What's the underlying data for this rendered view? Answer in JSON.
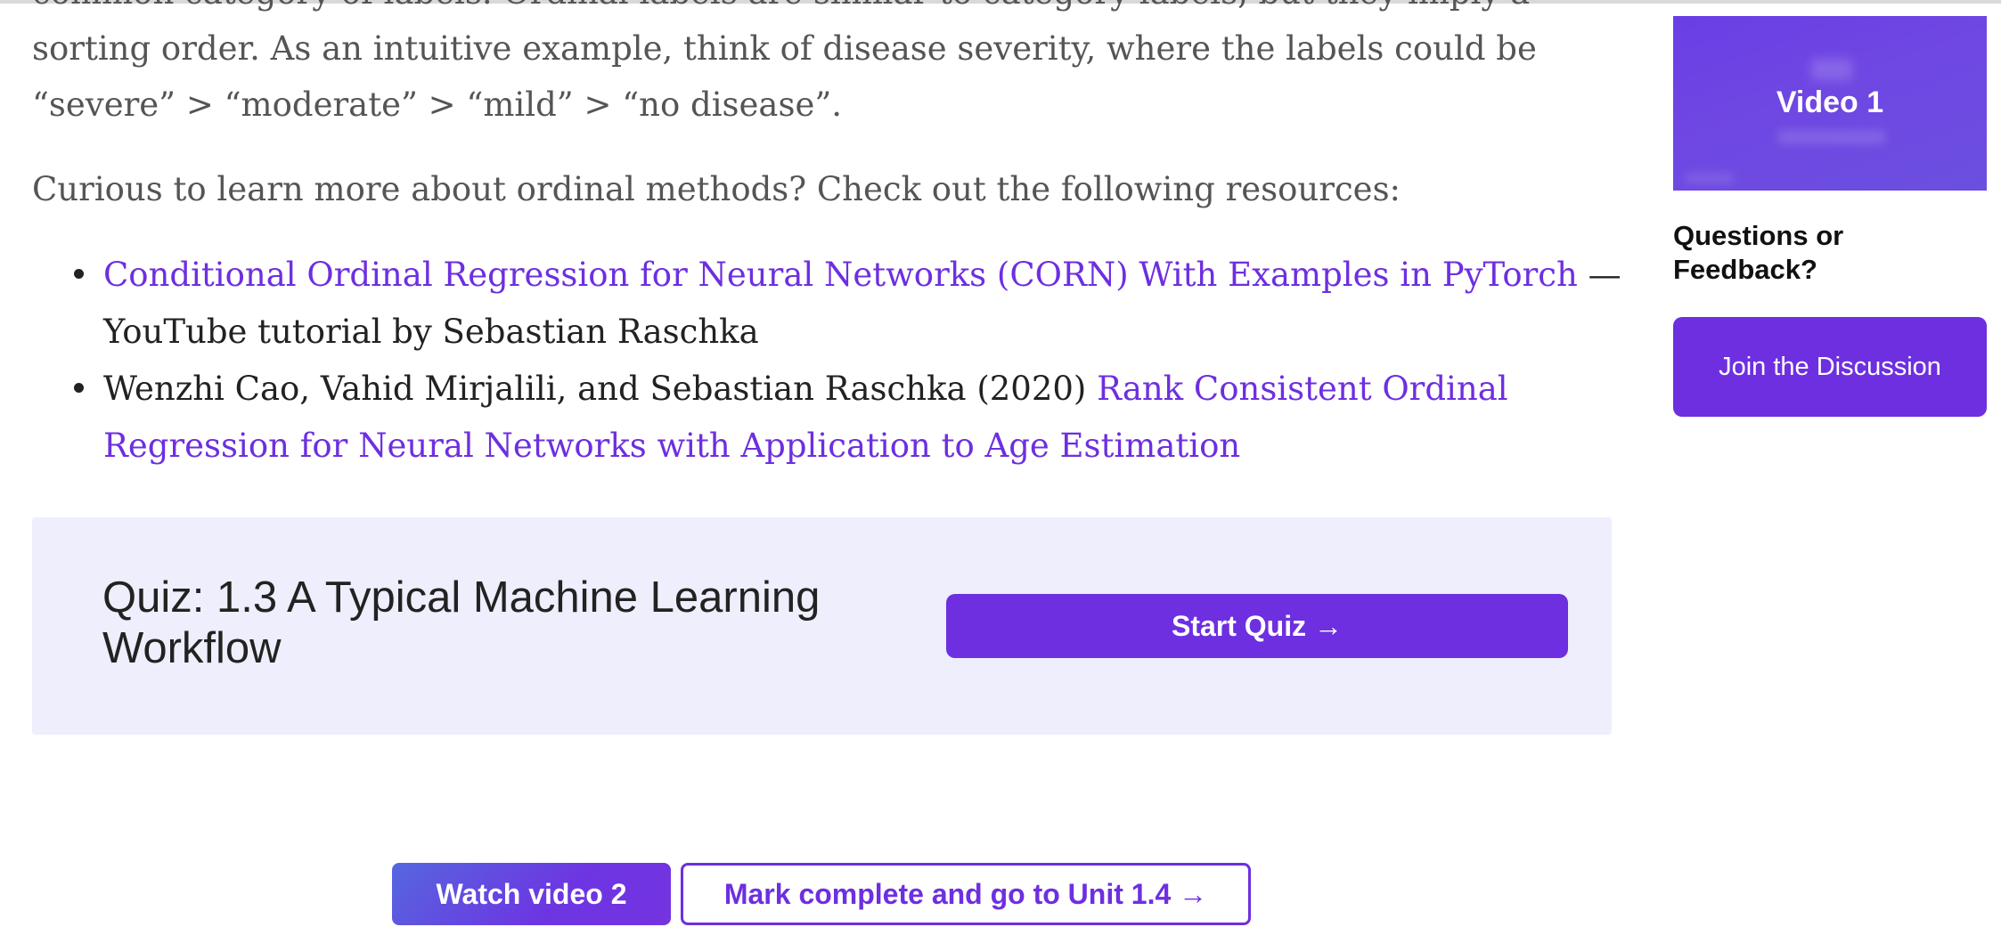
{
  "article": {
    "cut_paragraph_top_line": "common category of labels. Ordinal labels are similar to category labels, but they",
    "cut_paragraph_rest": "imply a sorting order. As an intuitive example, think of disease severity, where the labels could be “severe” > “moderate” > “mild” > “no disease”.",
    "curious_paragraph": "Curious to learn more about ordinal methods? Check out the following resources:",
    "resources": [
      {
        "link_text": "Conditional Ordinal Regression for Neural Networks (CORN) With Examples in PyTorch",
        "suffix": " — YouTube tutorial by Sebastian Raschka"
      },
      {
        "prefix": "Wenzhi Cao, Vahid Mirjalili, and Sebastian Raschka (2020) ",
        "link_text": "Rank Consistent Ordinal Regression for Neural Networks with Application to Age Estimation"
      }
    ]
  },
  "quiz": {
    "title": "Quiz: 1.3 A Typical Machine Learning Workflow",
    "start_label": "Start Quiz →"
  },
  "bottom_nav": {
    "watch_label": "Watch video 2",
    "mark_complete_label": "Mark complete and go to Unit 1.4 →"
  },
  "sidebar": {
    "video_label": "Video  1",
    "feedback_heading": "Questions or Feedback?",
    "join_label": "Join the Discussion"
  },
  "colors": {
    "accent": "#6d2fe0",
    "quiz_background": "#eeeefc",
    "body_text": "#555555"
  }
}
